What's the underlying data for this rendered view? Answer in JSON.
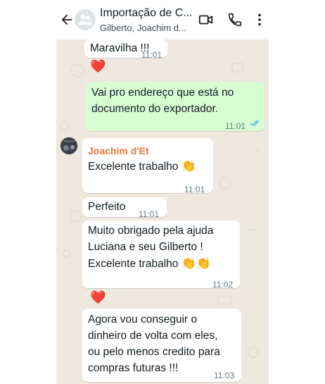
{
  "header": {
    "title": "Importação de C...",
    "subtitle": "Gilberto, Joachim d..."
  },
  "messages": [
    {
      "text": "Maravilha !!!",
      "time": "11:01",
      "reaction": "❤️"
    },
    {
      "lines": [
        "Vai pro endereço que está no",
        "documento do exportador."
      ],
      "time": "11:01"
    },
    {
      "sender": "Joachim d'Et",
      "text": "Excelente trabalho",
      "emoji": "👏",
      "time": "11:01"
    },
    {
      "text": "Perfeito",
      "time": "11:01"
    },
    {
      "lines": [
        "Muito obrigado pela ajuda",
        "Luciana e seu Gilberto !",
        "Excelente trabalho"
      ],
      "emoji": "👏👏",
      "time": "11:02",
      "reaction": "❤️"
    },
    {
      "lines": [
        "Agora vou conseguir o",
        "dinheiro de volta com eles,",
        "ou pelo menos credito para",
        "compras futuras !!!"
      ],
      "time": "11:03"
    }
  ],
  "colors": {
    "chat_background": "#efe8df",
    "outgoing_bubble": "#d9fdd3",
    "incoming_bubble": "#ffffff",
    "sender_name": "#e8773a",
    "read_ticks": "#53bdeb"
  },
  "icons": [
    "back-arrow-icon",
    "group-avatar-icon",
    "video-call-icon",
    "voice-call-icon",
    "more-options-icon",
    "double-check-icon",
    "heart-reaction-icon",
    "clapping-hands-icon"
  ]
}
